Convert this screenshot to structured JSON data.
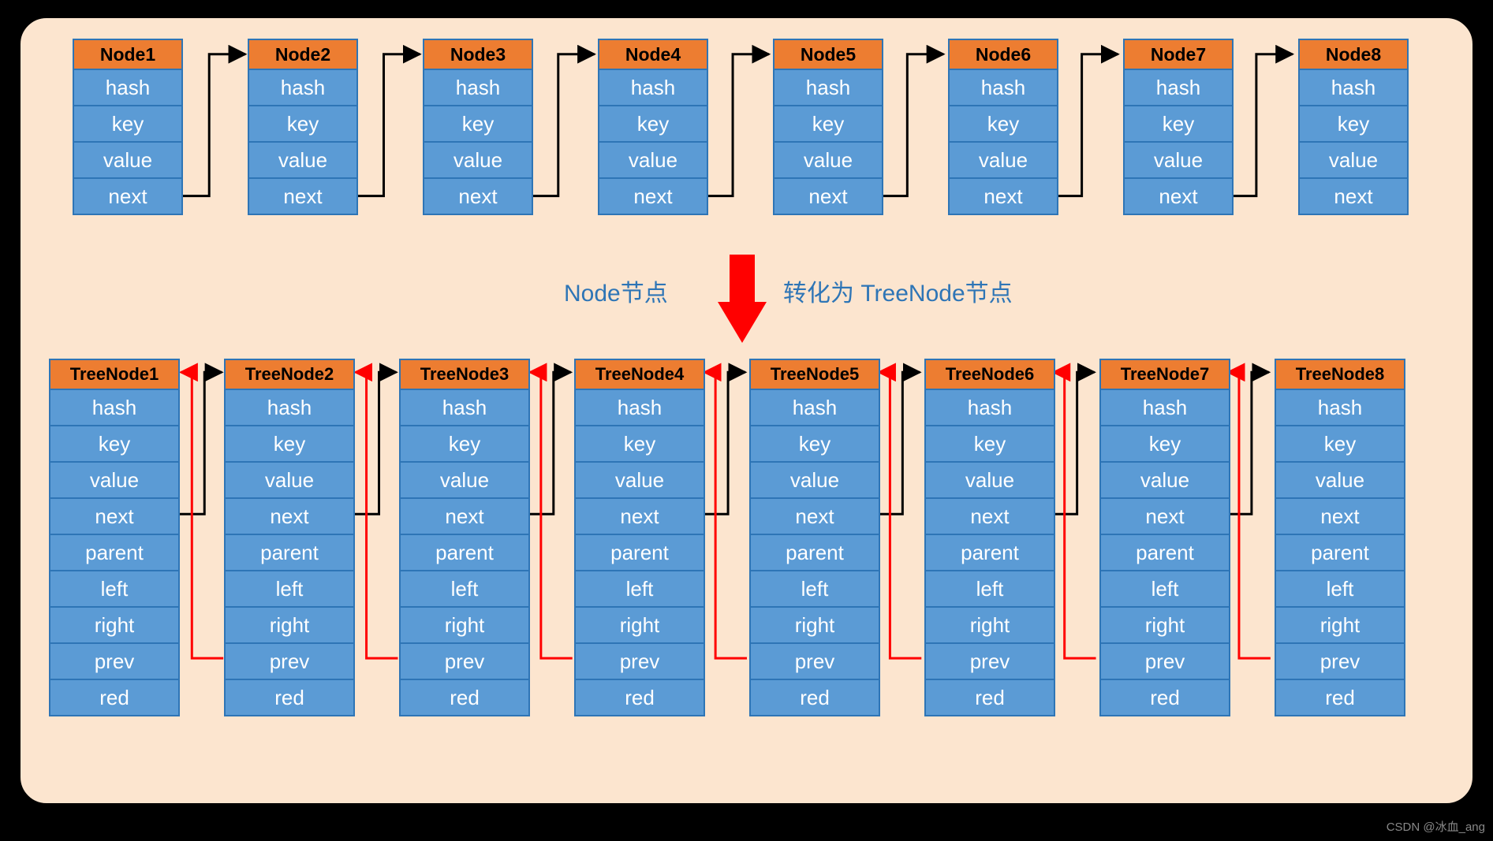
{
  "nodes": [
    {
      "title": "Node1",
      "fields": [
        "hash",
        "key",
        "value",
        "next"
      ]
    },
    {
      "title": "Node2",
      "fields": [
        "hash",
        "key",
        "value",
        "next"
      ]
    },
    {
      "title": "Node3",
      "fields": [
        "hash",
        "key",
        "value",
        "next"
      ]
    },
    {
      "title": "Node4",
      "fields": [
        "hash",
        "key",
        "value",
        "next"
      ]
    },
    {
      "title": "Node5",
      "fields": [
        "hash",
        "key",
        "value",
        "next"
      ]
    },
    {
      "title": "Node6",
      "fields": [
        "hash",
        "key",
        "value",
        "next"
      ]
    },
    {
      "title": "Node7",
      "fields": [
        "hash",
        "key",
        "value",
        "next"
      ]
    },
    {
      "title": "Node8",
      "fields": [
        "hash",
        "key",
        "value",
        "next"
      ]
    }
  ],
  "treeNodes": [
    {
      "title": "TreeNode1",
      "fields": [
        "hash",
        "key",
        "value",
        "next",
        "parent",
        "left",
        "right",
        "prev",
        "red"
      ]
    },
    {
      "title": "TreeNode2",
      "fields": [
        "hash",
        "key",
        "value",
        "next",
        "parent",
        "left",
        "right",
        "prev",
        "red"
      ]
    },
    {
      "title": "TreeNode3",
      "fields": [
        "hash",
        "key",
        "value",
        "next",
        "parent",
        "left",
        "right",
        "prev",
        "red"
      ]
    },
    {
      "title": "TreeNode4",
      "fields": [
        "hash",
        "key",
        "value",
        "next",
        "parent",
        "left",
        "right",
        "prev",
        "red"
      ]
    },
    {
      "title": "TreeNode5",
      "fields": [
        "hash",
        "key",
        "value",
        "next",
        "parent",
        "left",
        "right",
        "prev",
        "red"
      ]
    },
    {
      "title": "TreeNode6",
      "fields": [
        "hash",
        "key",
        "value",
        "next",
        "parent",
        "left",
        "right",
        "prev",
        "red"
      ]
    },
    {
      "title": "TreeNode7",
      "fields": [
        "hash",
        "key",
        "value",
        "next",
        "parent",
        "left",
        "right",
        "prev",
        "red"
      ]
    },
    {
      "title": "TreeNode8",
      "fields": [
        "hash",
        "key",
        "value",
        "next",
        "parent",
        "left",
        "right",
        "prev",
        "red"
      ]
    }
  ],
  "caption": {
    "left": "Node节点",
    "right": "转化为 TreeNode节点"
  },
  "watermark": "CSDN @冰血_ang",
  "colors": {
    "bg": "#fce5cf",
    "header": "#ed7d31",
    "cell": "#5b9bd5",
    "border": "#2e75b6",
    "caption": "#2e75b6",
    "nextArrow": "#000000",
    "prevArrow": "#ff0000",
    "bigArrow": "#ff0000"
  }
}
